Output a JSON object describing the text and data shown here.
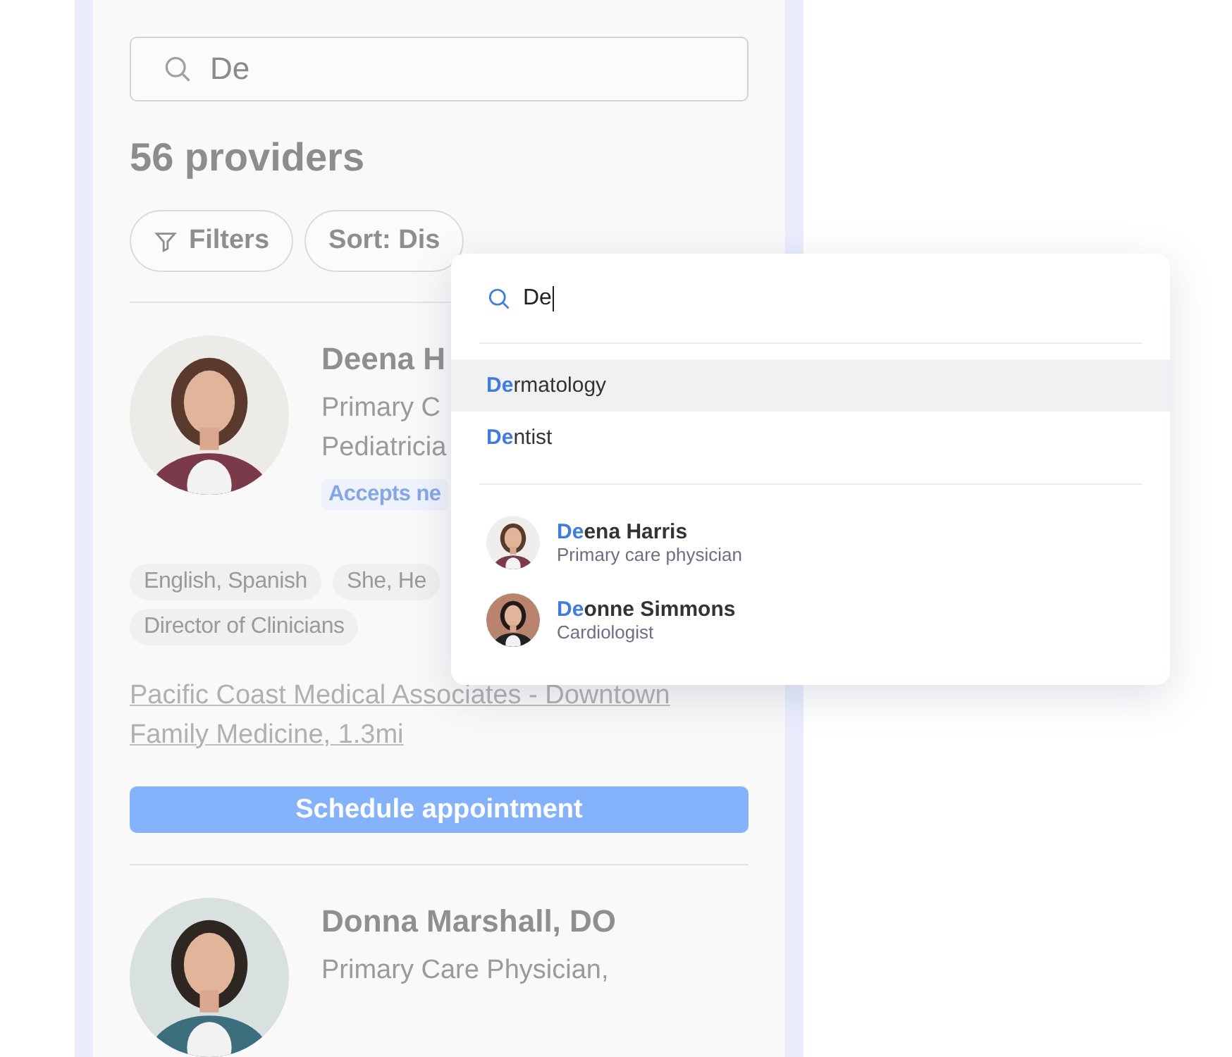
{
  "search": {
    "value": "De"
  },
  "result_count": "56 providers",
  "toolbar": [
    {
      "kind": "filter",
      "label": "Filters"
    },
    {
      "kind": "sort",
      "label": "Sort: Dis"
    }
  ],
  "providers": [
    {
      "name": "Deena H",
      "specialty_lines": [
        "Primary C",
        "Pediatricia"
      ],
      "badge": "Accepts ne",
      "tags": [
        "English, Spanish",
        "She, He",
        "Director of Clinicians"
      ],
      "location": "Pacific Coast Medical Associates - Downtown Family Medicine, 1.3mi",
      "action": "Schedule appointment"
    },
    {
      "name": "Donna Marshall, DO",
      "specialty_lines": [
        "Primary Care Physician,"
      ]
    }
  ],
  "autocomplete": {
    "query": "De",
    "specialties": [
      {
        "label": "**De**rmatology",
        "selected": true
      },
      {
        "label": "**De**ntist",
        "selected": false
      }
    ],
    "people": [
      {
        "name": "**De**ena Harris",
        "role": "Primary care physician"
      },
      {
        "name": "**De**onne Simmons",
        "role": "Cardiologist"
      }
    ]
  }
}
